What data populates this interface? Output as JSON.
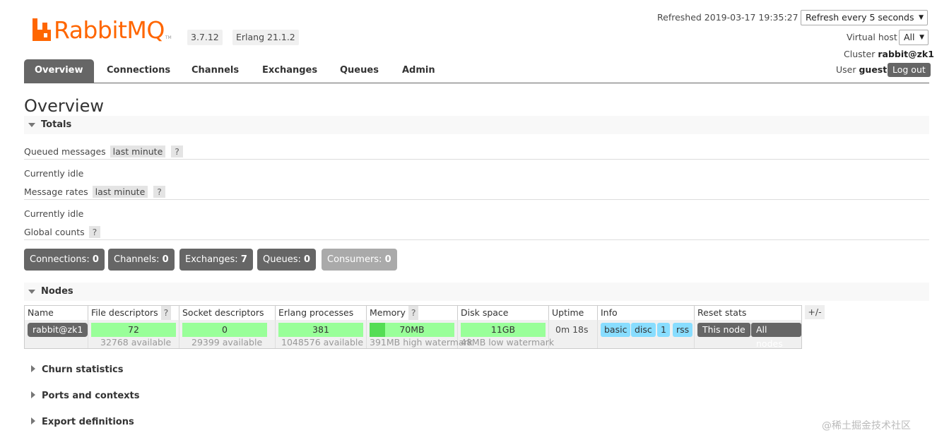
{
  "header": {
    "logo_text": "RabbitMQ",
    "logo_tm": "TM",
    "version": "3.7.12",
    "erlang": "Erlang 21.1.2",
    "refreshed_label": "Refreshed 2019-03-17 19:35:27",
    "refresh_select": "Refresh every 5 seconds",
    "vhost_label": "Virtual host",
    "vhost_value": "All",
    "cluster_label": "Cluster",
    "cluster_name": "rabbit@zk1",
    "user_label": "User",
    "user_name": "guest",
    "logout": "Log out"
  },
  "nav": {
    "tabs": [
      "Overview",
      "Connections",
      "Channels",
      "Exchanges",
      "Queues",
      "Admin"
    ],
    "active": "Overview"
  },
  "page": {
    "title": "Overview",
    "totals": {
      "heading": "Totals",
      "queued_label": "Queued messages",
      "queued_range": "last minute",
      "help": "?",
      "queued_status": "Currently idle",
      "rates_label": "Message rates",
      "rates_range": "last minute",
      "rates_status": "Currently idle",
      "global_label": "Global counts",
      "counts": [
        {
          "label": "Connections:",
          "value": "0"
        },
        {
          "label": "Channels:",
          "value": "0"
        },
        {
          "label": "Exchanges:",
          "value": "7"
        },
        {
          "label": "Queues:",
          "value": "0"
        },
        {
          "label": "Consumers:",
          "value": "0"
        }
      ]
    },
    "nodes": {
      "heading": "Nodes",
      "columns": [
        "Name",
        "File descriptors",
        "Socket descriptors",
        "Erlang processes",
        "Memory",
        "Disk space",
        "Uptime",
        "Info",
        "Reset stats"
      ],
      "plusminus": "+/-",
      "row": {
        "name": "rabbit@zk1",
        "fd": "72",
        "fd_avail": "32768 available",
        "sd": "0",
        "sd_avail": "29399 available",
        "ep": "381",
        "ep_avail": "1048576 available",
        "memory": "70MB",
        "memory_fraction": 0.18,
        "memory_sub": "391MB high watermark",
        "disk": "11GB",
        "disk_sub": "48MB low watermark",
        "uptime": "0m 18s",
        "info": [
          "basic",
          "disc",
          "1",
          "rss"
        ],
        "reset_this": "This node",
        "reset_all": "All nodes"
      }
    },
    "sections": [
      "Churn statistics",
      "Ports and contexts",
      "Export definitions"
    ]
  },
  "watermark": "@稀土掘金技术社区",
  "colors": {
    "brand": "#ff6600",
    "nav_active": "#666666",
    "bar_green": "#99ff99",
    "info_blue": "#88ddff"
  }
}
